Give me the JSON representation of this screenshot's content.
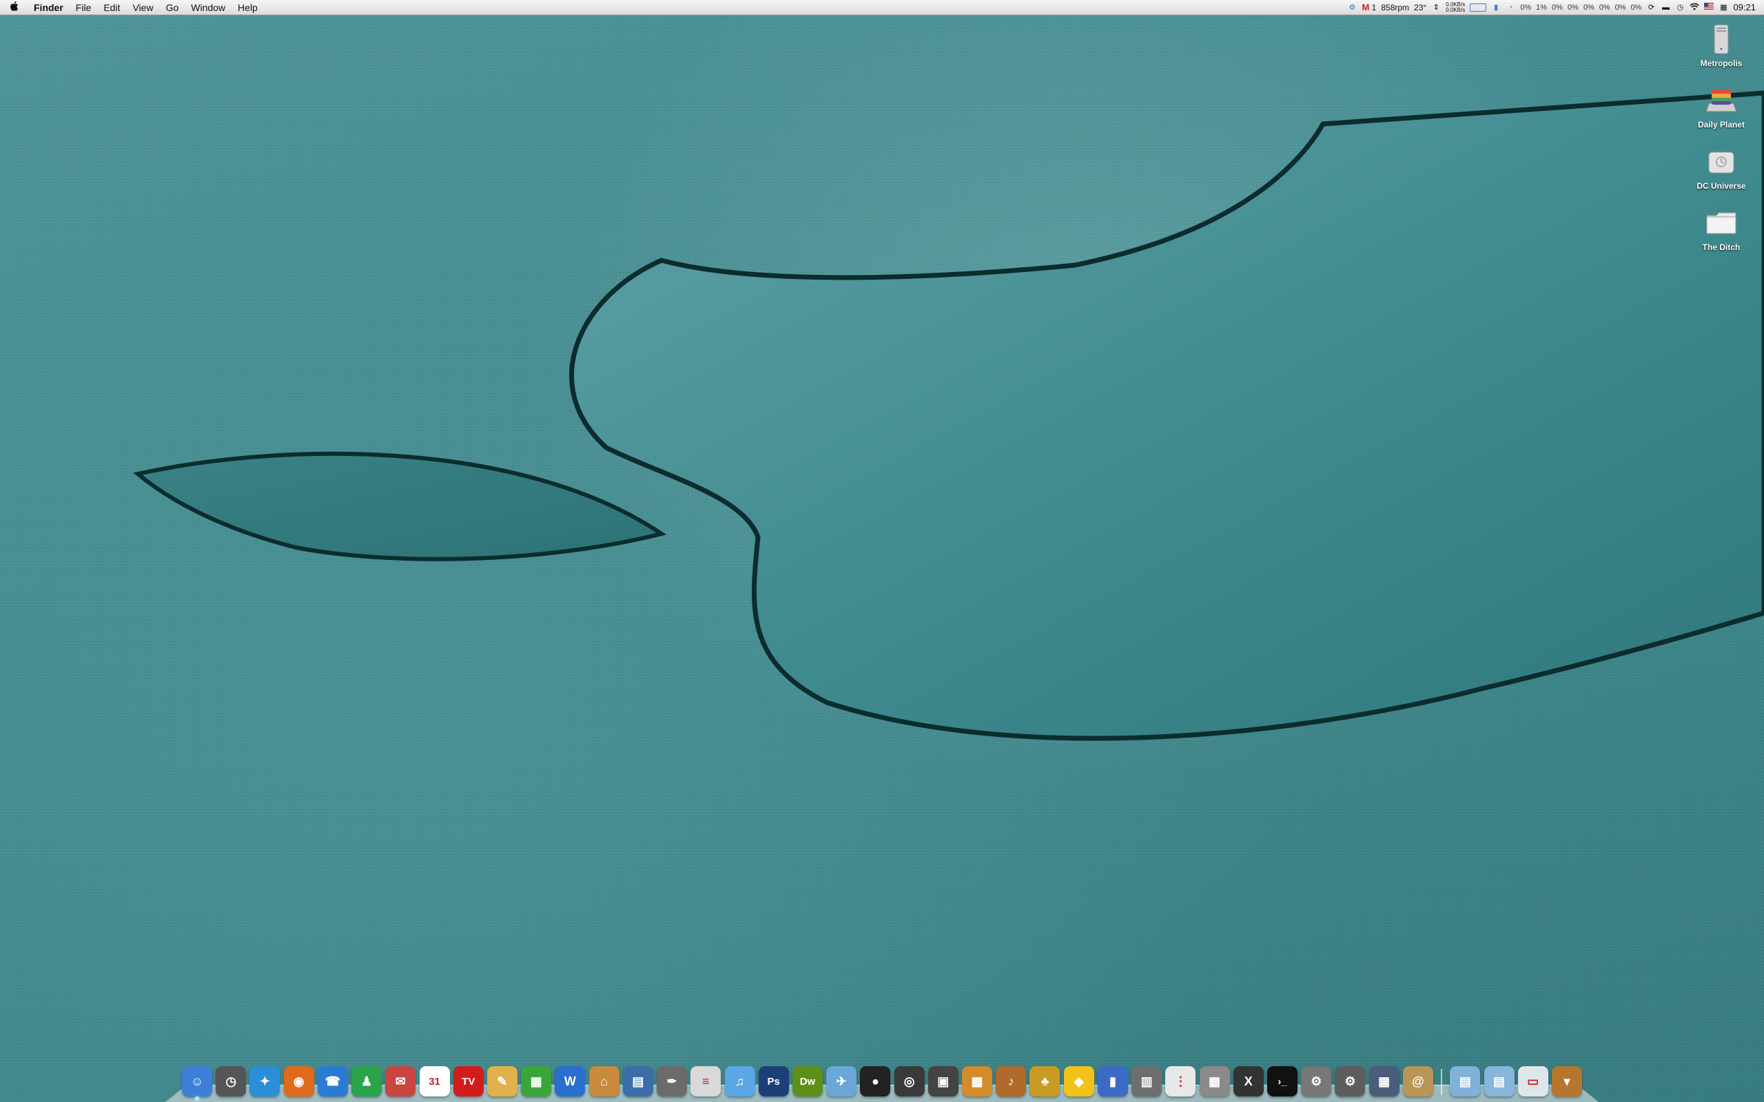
{
  "menubar": {
    "apple_icon": "apple-icon",
    "app_name": "Finder",
    "menus": [
      "File",
      "Edit",
      "View",
      "Go",
      "Window",
      "Help"
    ],
    "status": {
      "gmail_count": "1",
      "fan_speed": "858rpm",
      "temperature": "23°",
      "net_up": "0.0KB/s",
      "net_down": "0.0KB/s",
      "cpu_cores": [
        "0%",
        "1%",
        "0%",
        "0%",
        "0%",
        "0%",
        "0%",
        "0%"
      ],
      "clock": "09:21",
      "icons": [
        "time-machine-icon",
        "display-icon",
        "sync-icon",
        "wifi-icon",
        "flag-icon",
        "calendar-icon"
      ]
    }
  },
  "desktop": {
    "icons": [
      {
        "label": "Metropolis",
        "icon": "tower-drive-icon"
      },
      {
        "label": "Daily Planet",
        "icon": "external-drive-icon"
      },
      {
        "label": "DC Universe",
        "icon": "time-machine-drive-icon"
      },
      {
        "label": "The Ditch",
        "icon": "folder-icon"
      }
    ]
  },
  "dock": {
    "apps": [
      {
        "name": "finder-icon",
        "glyph": "☺",
        "color": "#3d7fd6"
      },
      {
        "name": "clock-icon",
        "glyph": "◷",
        "color": "#555"
      },
      {
        "name": "safari-icon",
        "glyph": "✦",
        "color": "#2b8fd8"
      },
      {
        "name": "firefox-icon",
        "glyph": "◉",
        "color": "#e06a1b"
      },
      {
        "name": "video-chat-icon",
        "glyph": "☎",
        "color": "#2a7bd3"
      },
      {
        "name": "contacts-icon",
        "glyph": "♟",
        "color": "#2aa34a"
      },
      {
        "name": "mail-icon",
        "glyph": "✉",
        "color": "#c9453f"
      },
      {
        "name": "ical-icon",
        "glyph": "31",
        "color": "#ffffff"
      },
      {
        "name": "tv-icon",
        "glyph": "TV",
        "color": "#d21c1c"
      },
      {
        "name": "pages-icon",
        "glyph": "✎",
        "color": "#e1b24c"
      },
      {
        "name": "numbers-icon",
        "glyph": "▦",
        "color": "#3aa63a"
      },
      {
        "name": "word-icon",
        "glyph": "W",
        "color": "#2a6fcf"
      },
      {
        "name": "keynote-icon",
        "glyph": "⌂",
        "color": "#c88a3c"
      },
      {
        "name": "chart-icon",
        "glyph": "▤",
        "color": "#3b6ea8"
      },
      {
        "name": "quill-icon",
        "glyph": "✒",
        "color": "#6b6b6b"
      },
      {
        "name": "textedit-icon",
        "glyph": "≡",
        "color": "#d9d9d9"
      },
      {
        "name": "itunes-icon",
        "glyph": "♫",
        "color": "#5ca6e6"
      },
      {
        "name": "photoshop-icon",
        "glyph": "Ps",
        "color": "#1c3f7a"
      },
      {
        "name": "dreamweaver-icon",
        "glyph": "Dw",
        "color": "#5e8f1a"
      },
      {
        "name": "preview-icon",
        "glyph": "✈",
        "color": "#6aa7d8"
      },
      {
        "name": "front-row-icon",
        "glyph": "●",
        "color": "#222"
      },
      {
        "name": "aperture-icon",
        "glyph": "◎",
        "color": "#3a3a3a"
      },
      {
        "name": "photo-booth-icon",
        "glyph": "▣",
        "color": "#444"
      },
      {
        "name": "iphoto-icon",
        "glyph": "▩",
        "color": "#d48b2a"
      },
      {
        "name": "garageband-icon",
        "glyph": "♪",
        "color": "#b06a2c"
      },
      {
        "name": "pineapple-icon",
        "glyph": "♣",
        "color": "#c99b22"
      },
      {
        "name": "cyberduck-icon",
        "glyph": "◆",
        "color": "#f2c21b"
      },
      {
        "name": "books-icon",
        "glyph": "▮",
        "color": "#3b6ac7"
      },
      {
        "name": "system-profiler-icon",
        "glyph": "▥",
        "color": "#6e6e6e"
      },
      {
        "name": "remote-icon",
        "glyph": "⋮",
        "color": "#e8e8e8"
      },
      {
        "name": "calculator-icon",
        "glyph": "▦",
        "color": "#8a8a8a"
      },
      {
        "name": "x11-icon",
        "glyph": "X",
        "color": "#333"
      },
      {
        "name": "terminal-icon",
        "glyph": "›_",
        "color": "#111"
      },
      {
        "name": "automator-icon",
        "glyph": "⚙",
        "color": "#777"
      },
      {
        "name": "system-preferences-icon",
        "glyph": "⚙",
        "color": "#5d5d5d"
      },
      {
        "name": "expose-icon",
        "glyph": "▦",
        "color": "#4a5d7a"
      },
      {
        "name": "address-book-icon",
        "glyph": "@",
        "color": "#b99557"
      }
    ],
    "stacks": [
      {
        "name": "applications-stack-icon",
        "glyph": "▤",
        "color": "#7fb2d6"
      },
      {
        "name": "documents-stack-icon",
        "glyph": "▤",
        "color": "#86b6da"
      },
      {
        "name": "downloads-stack-icon",
        "glyph": "▭",
        "color": "#dfe6ea"
      },
      {
        "name": "trash-icon",
        "glyph": "▾",
        "color": "#b7762e"
      }
    ]
  }
}
